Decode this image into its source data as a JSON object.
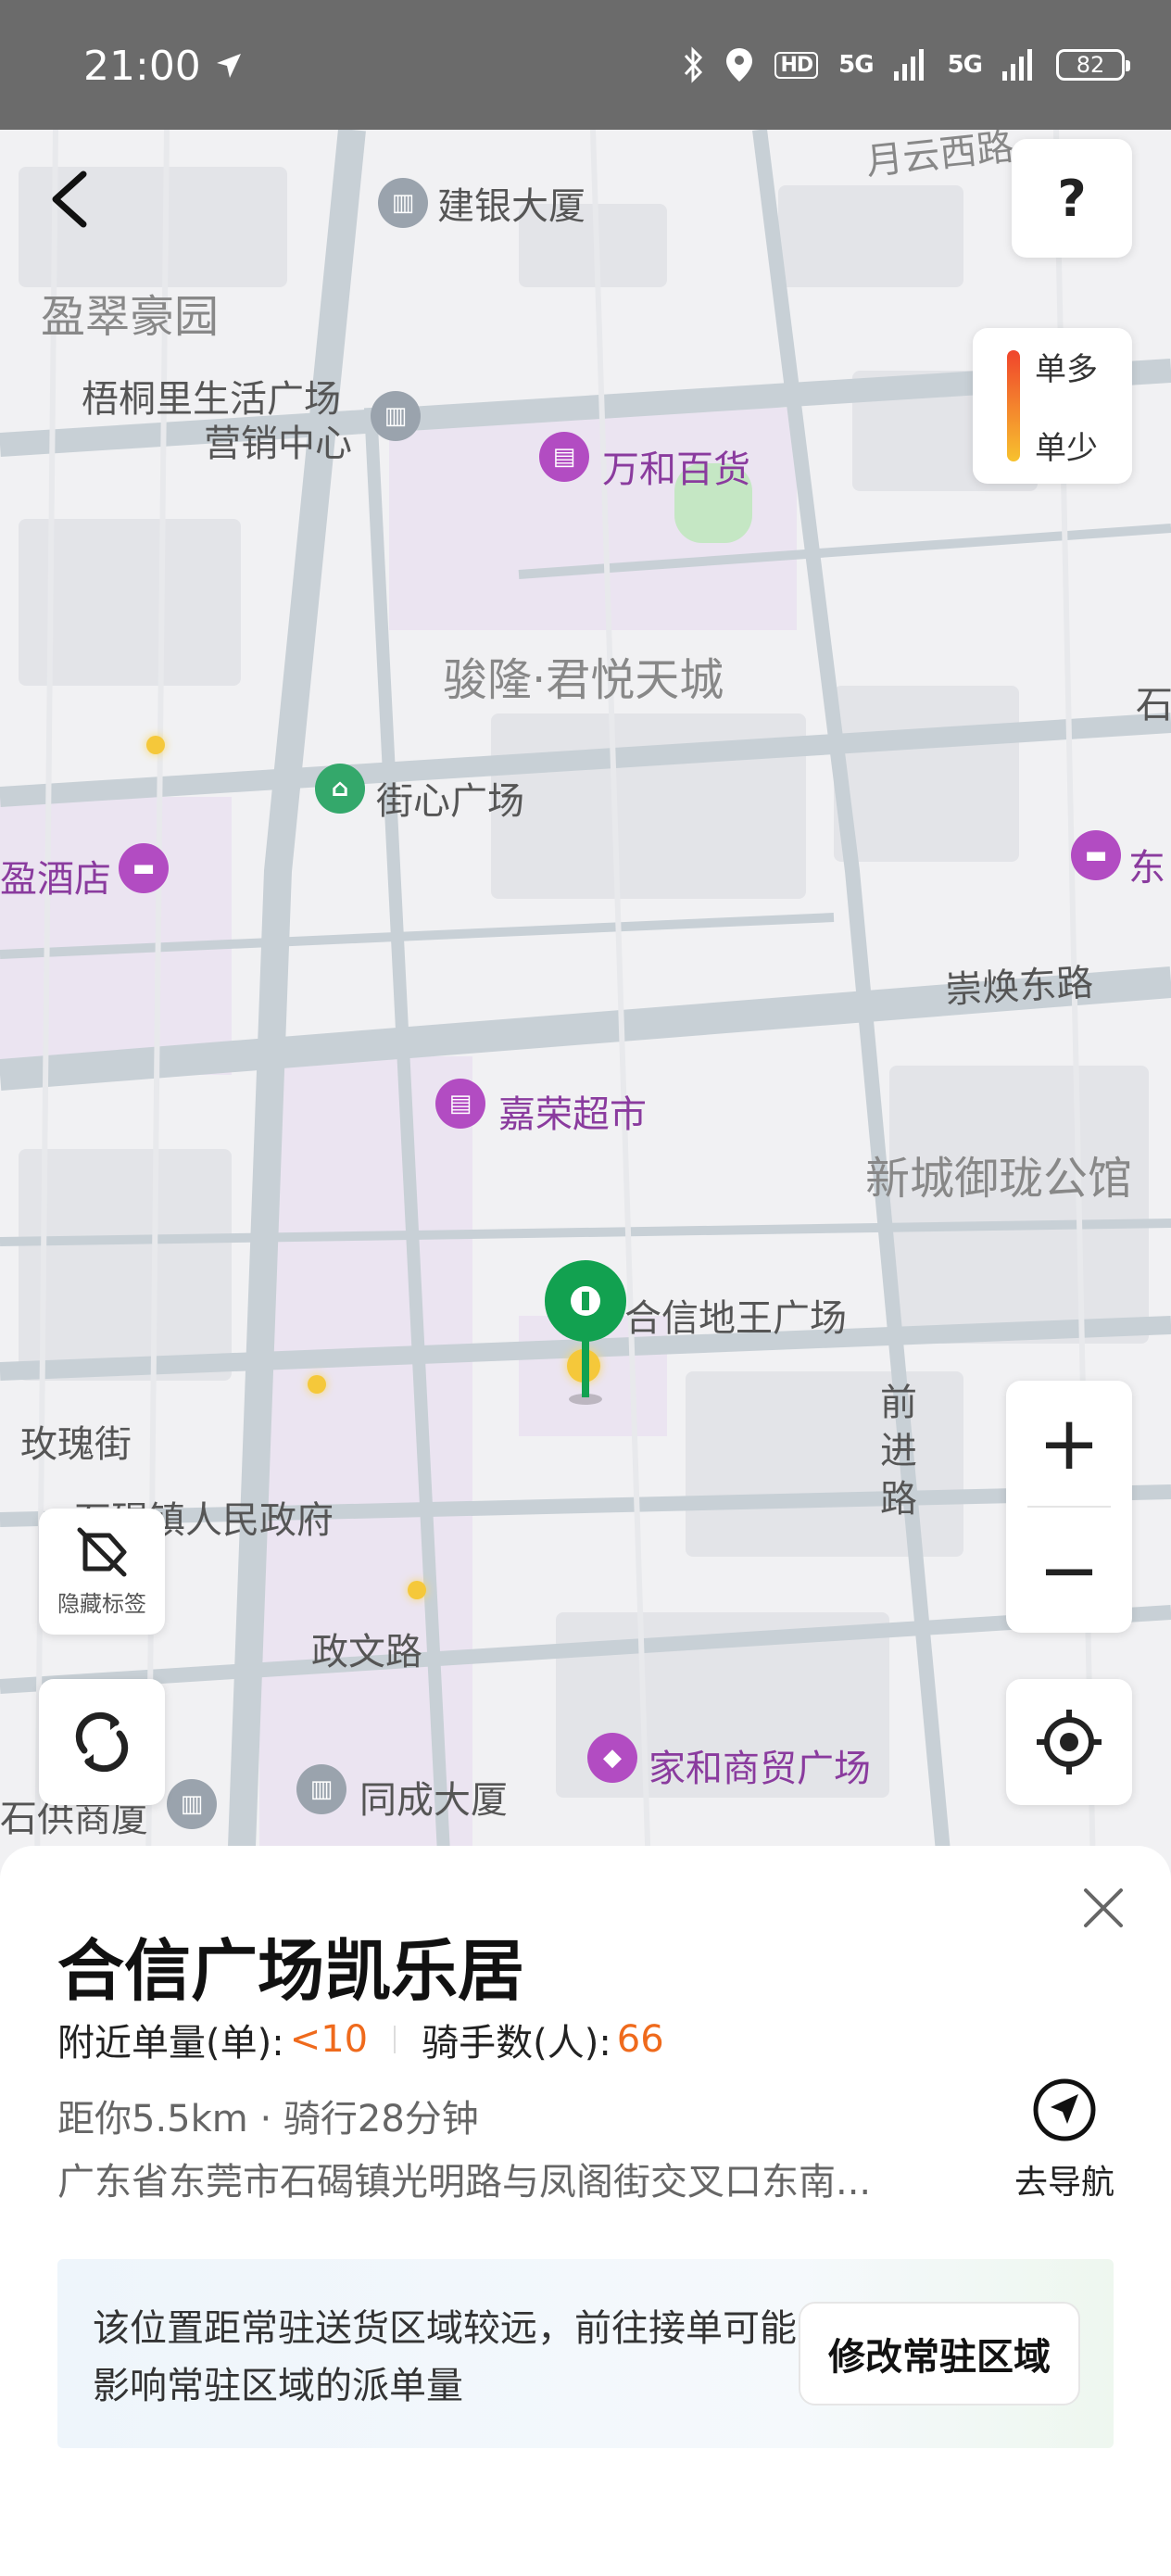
{
  "status_bar": {
    "time": "21:00",
    "signal_1": "5G",
    "signal_2": "5G",
    "hd_label": "HD",
    "battery": "82"
  },
  "map": {
    "labels": {
      "jianyin": "建银大厦",
      "yingcui": "盈翠豪园",
      "wutong_1": "梧桐里生活广场",
      "wutong_2": "营销中心",
      "wanhe": "万和百货",
      "junlong": "骏隆·君悦天城",
      "jiexin": "街心广场",
      "hotel": "盈酒店",
      "dong": "东",
      "shi": "石",
      "yue": "月云西路",
      "chonghuan": "崇焕东路",
      "jiarong": "嘉荣超市",
      "xincheng": "新城御珑公馆",
      "hexin": "合信地王广场",
      "qianjin": "前进路",
      "meigui": "玫瑰街",
      "zhengfu": "石碣镇人民政府",
      "zhengwen": "政文路",
      "jiahe": "家和商贸广场",
      "tongcheng": "同成大厦",
      "shigong": "石供商厦"
    },
    "legend": {
      "high": "单多",
      "low": "单少"
    },
    "help_label": "?",
    "hide_labels": "隐藏标签",
    "zoom_in": "+",
    "zoom_out": "−"
  },
  "sheet": {
    "title": "合信广场凯乐居",
    "orders_label": "附近单量(单):",
    "orders_value": "<10",
    "riders_label": "骑手数(人):",
    "riders_value": "66",
    "distance": "距你5.5km · 骑行28分钟",
    "address": "广东省东莞市石碣镇光明路与凤阁街交叉口东南...",
    "navigate_label": "去导航",
    "notice": "该位置距常驻送货区域较远，前往接单可能影响常驻区域的派单量",
    "modify_button": "修改常驻区域"
  },
  "colors": {
    "accent_orange": "#ef6a1c",
    "pin_green": "#12a150",
    "poi_purple": "#b24cc2"
  }
}
